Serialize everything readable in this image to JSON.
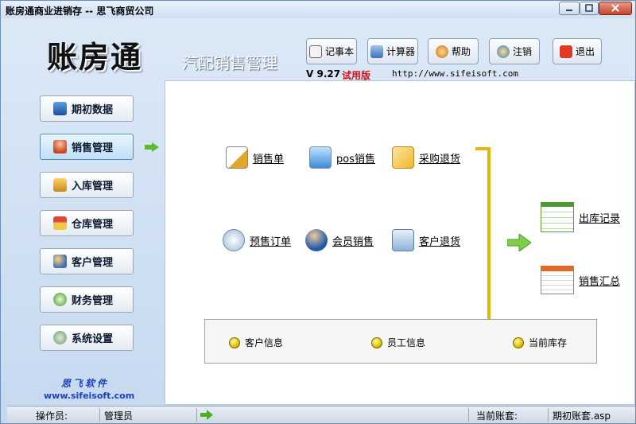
{
  "window": {
    "title": "账房通商业进销存 -- 思飞商贸公司"
  },
  "header": {
    "logo_text": "账房通",
    "subtitle": "汽配销售管理",
    "version": "V 9.27",
    "edition": "试用版",
    "url": "http://www.sifeisoft.com"
  },
  "toolbar": {
    "notepad": "记事本",
    "calculator": "计算器",
    "help": "帮助",
    "logout": "注销",
    "exit": "退出"
  },
  "sidebar": {
    "items": [
      {
        "label": "期初数据"
      },
      {
        "label": "销售管理"
      },
      {
        "label": "入库管理"
      },
      {
        "label": "仓库管理"
      },
      {
        "label": "客户管理"
      },
      {
        "label": "财务管理"
      },
      {
        "label": "系统设置"
      }
    ],
    "brand_name": "思飞软件",
    "brand_url": "www.sifeisoft.com"
  },
  "main": {
    "row1": [
      "销售单",
      "pos销售",
      "采购退货"
    ],
    "row2": [
      "预售订单",
      "会员销售",
      "客户退货"
    ],
    "right": [
      "出库记录",
      "销售汇总"
    ],
    "info": [
      "客户信息",
      "员工信息",
      "当前库存"
    ]
  },
  "status": {
    "operator_label": "操作员:",
    "operator_value": "管理员",
    "account_label": "当前账套:",
    "account_value": "期初账套.asp"
  },
  "colors": {
    "accent": "#e5b800",
    "link_text": "#000000",
    "brand": "#1b3fc0",
    "trial": "#d0141b"
  }
}
